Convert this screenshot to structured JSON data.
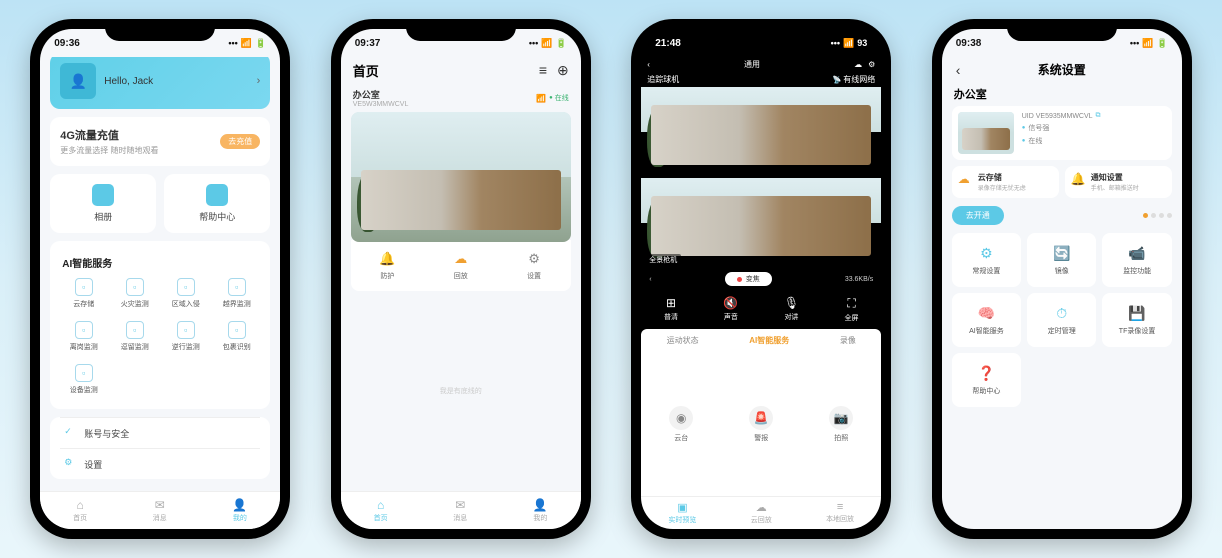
{
  "phones": [
    {
      "time": "09:36",
      "greeting": "Hello, Jack",
      "topup": {
        "title": "4G流量充值",
        "sub": "更多流量选择 随时随地观看",
        "btn": "去充值"
      },
      "dual": [
        {
          "label": "相册"
        },
        {
          "label": "帮助中心"
        }
      ],
      "svc_title": "AI智能服务",
      "svc": [
        "云存储",
        "火灾监测",
        "区域入侵",
        "越界监测",
        "离岗监测",
        "逗留监测",
        "逆行监测",
        "包裹识别",
        "设备监测"
      ],
      "rows": [
        "账号与安全",
        "设置"
      ],
      "nav": [
        "首页",
        "消息",
        "我的"
      ],
      "nav_active": 2
    },
    {
      "time": "09:37",
      "title": "首页",
      "device": "办公室",
      "device_sub": "VE5W3MMWCVL",
      "status": "在线",
      "actions": [
        "防护",
        "回放",
        "设置"
      ],
      "action_active": 1,
      "empty": "我是有底线的",
      "nav": [
        "首页",
        "消息",
        "我的"
      ],
      "nav_active": 0
    },
    {
      "time": "21:48",
      "device_top": "追踪球机",
      "device_top_net": "有线网络",
      "header_center": "通用",
      "label_bottom": "全景枪机",
      "pill": "变焦",
      "speed": "33.6KB/s",
      "ctrl": [
        "普清",
        "声音",
        "对讲",
        "全屏"
      ],
      "tabs": [
        "运动状态",
        "AI智能服务",
        "录像"
      ],
      "tab_active": 1,
      "ptz": [
        "云台",
        "警报",
        "拍照"
      ],
      "bnav": [
        "实时预览",
        "云回放",
        "本地回放"
      ],
      "bnav_active": 0
    },
    {
      "time": "09:38",
      "title": "系统设置",
      "device": "办公室",
      "uid": "UID VE5935MMWCVL",
      "signal": "信号强",
      "online": "在线",
      "promo": [
        {
          "title": "云存储",
          "sub": "录像存储无忧无虑",
          "icon_color": "#f0a030"
        },
        {
          "title": "通知设置",
          "sub": "手机、邮箱推送时",
          "icon_color": "#5cc9e6"
        }
      ],
      "open_btn": "去开通",
      "grid": [
        "常规设置",
        "镜像",
        "监控功能",
        "AI智能服务",
        "定时管理",
        "TF录像设置",
        "帮助中心"
      ]
    }
  ]
}
